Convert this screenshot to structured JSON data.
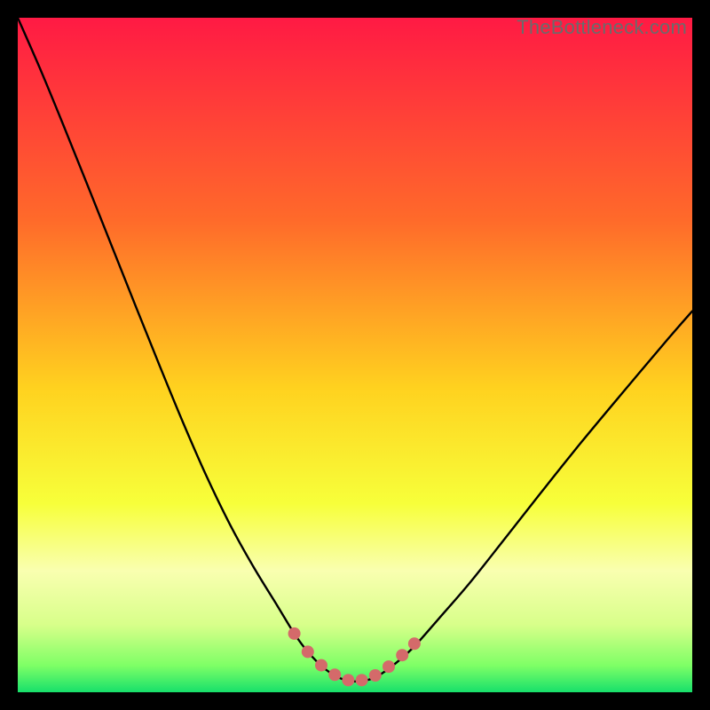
{
  "watermark": "TheBottleneck.com",
  "chart_data": {
    "type": "line",
    "title": "",
    "xlabel": "",
    "ylabel": "",
    "xlim": [
      0,
      100
    ],
    "ylim": [
      0,
      100
    ],
    "grid": false,
    "legend": false,
    "background_gradient": {
      "stops": [
        {
          "offset": 0.0,
          "color": "#ff1a44"
        },
        {
          "offset": 0.3,
          "color": "#ff6a2a"
        },
        {
          "offset": 0.55,
          "color": "#ffd21f"
        },
        {
          "offset": 0.72,
          "color": "#f7ff3a"
        },
        {
          "offset": 0.82,
          "color": "#f9ffb0"
        },
        {
          "offset": 0.9,
          "color": "#d8ff8a"
        },
        {
          "offset": 0.96,
          "color": "#7fff66"
        },
        {
          "offset": 1.0,
          "color": "#17e06b"
        }
      ]
    },
    "series": [
      {
        "name": "bottleneck-curve",
        "x": [
          0.0,
          3.5,
          7.0,
          10.5,
          14.0,
          17.5,
          21.0,
          24.5,
          28.0,
          31.5,
          35.0,
          38.5,
          41.0,
          43.0,
          45.5,
          48.0,
          50.0,
          52.5,
          55.0,
          58.5,
          62.5,
          67.0,
          72.0,
          77.5,
          83.5,
          90.0,
          96.5,
          100.0
        ],
        "y": [
          100.0,
          92.0,
          83.5,
          74.8,
          66.0,
          57.2,
          48.5,
          40.0,
          32.0,
          24.8,
          18.5,
          12.8,
          8.7,
          6.0,
          3.5,
          2.0,
          1.6,
          2.0,
          3.5,
          6.5,
          11.0,
          16.2,
          22.5,
          29.5,
          37.0,
          44.8,
          52.5,
          56.5
        ]
      }
    ],
    "markers": {
      "name": "bottleneck-bottom-dots",
      "x": [
        41.0,
        43.0,
        45.0,
        47.0,
        49.0,
        51.0,
        53.0,
        55.0,
        57.0,
        58.8
      ],
      "y": [
        8.7,
        6.0,
        4.0,
        2.6,
        1.8,
        1.8,
        2.5,
        3.8,
        5.5,
        7.2
      ],
      "color": "#d46a6a",
      "radius": 7
    }
  }
}
